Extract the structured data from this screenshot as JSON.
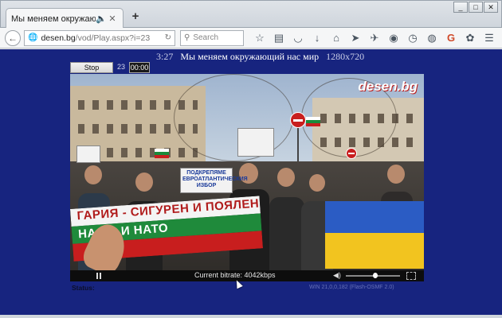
{
  "browser": {
    "tab_title": "Мы меняем окружающий на…",
    "url_host": "desen.bg",
    "url_path": "/vod/Play.aspx?i=23",
    "search_placeholder": "Search",
    "new_tab": "+",
    "window_controls": [
      "_",
      "□",
      "✕"
    ],
    "toolbar_icons": [
      "star-icon",
      "reading-list-icon",
      "pocket-icon",
      "download-icon",
      "home-icon",
      "send-icon",
      "extension-icon",
      "vpn-icon",
      "history-icon",
      "chat-icon",
      "google-icon",
      "addon-icon",
      "menu-icon"
    ]
  },
  "page": {
    "duration": "3:27",
    "title": "Мы меняем окружающий нас мир",
    "resolution": "1280x720",
    "stop_label": "Stop",
    "counter": "23",
    "time": "00:00"
  },
  "video": {
    "watermark": "desen.bg",
    "banner_line1": "ГАРИЯ - СИГУРЕН И ПОЯЛЕН",
    "banner_line2": "НА ЕС И НАТО",
    "sign_main": "ПОДКРЕПЯМЕ ЕВРОАТЛАНТИЧЕСКИЯ ИЗБОР",
    "bitrate": "Current bitrate: 4042kbps",
    "volume_level": 0.55
  },
  "status": {
    "label": "Status:",
    "version": "WIN 21,0,0,182 (Flash-OSMF 2.0)"
  }
}
